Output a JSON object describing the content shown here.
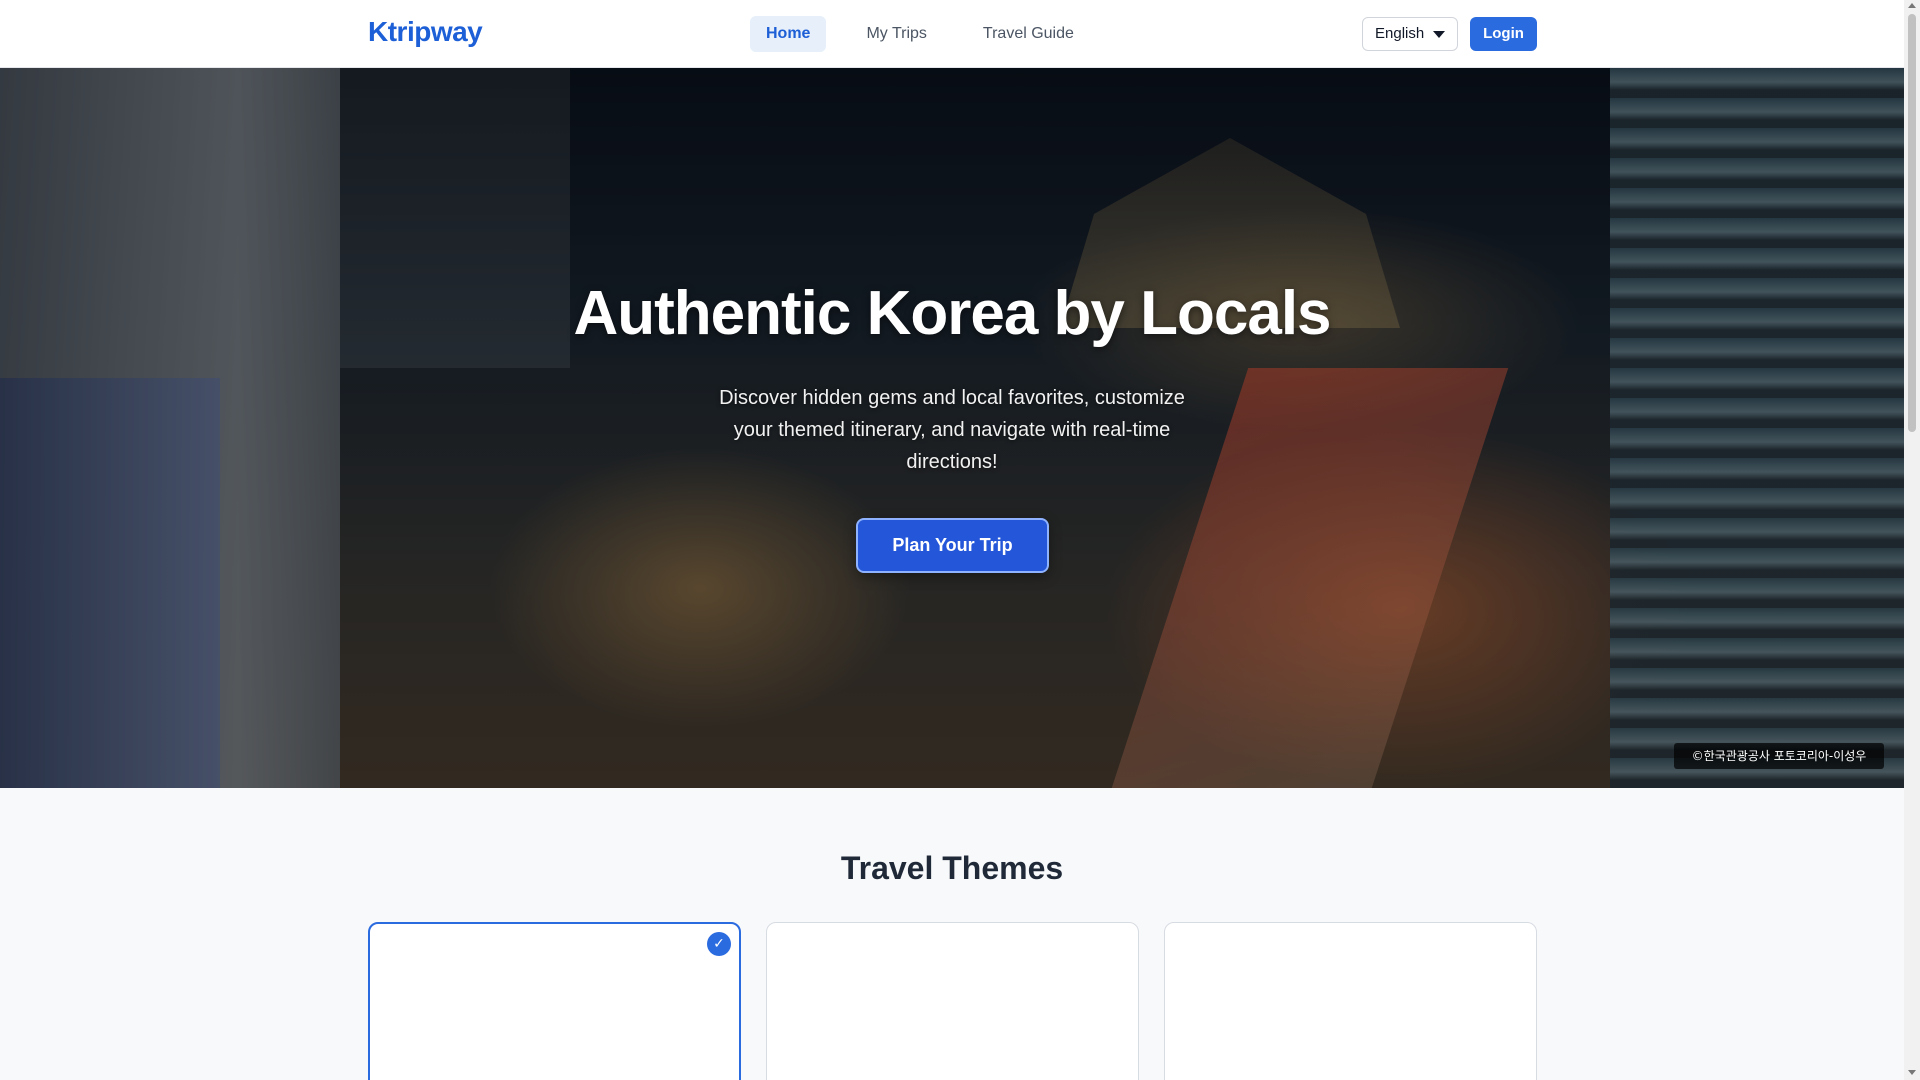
{
  "header": {
    "logo": "Ktripway",
    "nav": [
      {
        "label": "Home",
        "active": true
      },
      {
        "label": "My Trips",
        "active": false
      },
      {
        "label": "Travel Guide",
        "active": false
      }
    ],
    "language": "English",
    "login_label": "Login"
  },
  "hero": {
    "title": "Authentic Korea by Locals",
    "subtitle": "Discover hidden gems and local favorites, customize your themed itinerary, and navigate with real-time directions!",
    "cta_label": "Plan Your Trip",
    "photo_credit": "©한국관광공사 포토코리아-이성우"
  },
  "themes": {
    "title": "Travel Themes",
    "cards": [
      {
        "selected": true,
        "badge": "✓"
      },
      {
        "selected": false
      },
      {
        "selected": false
      }
    ]
  },
  "colors": {
    "brand": "#1d5fd6",
    "primary_button": "#2b6be0",
    "nav_active_bg": "#e6effa"
  },
  "icons": {
    "language_caret": "chevron-down-icon",
    "theme_check": "check-icon"
  }
}
